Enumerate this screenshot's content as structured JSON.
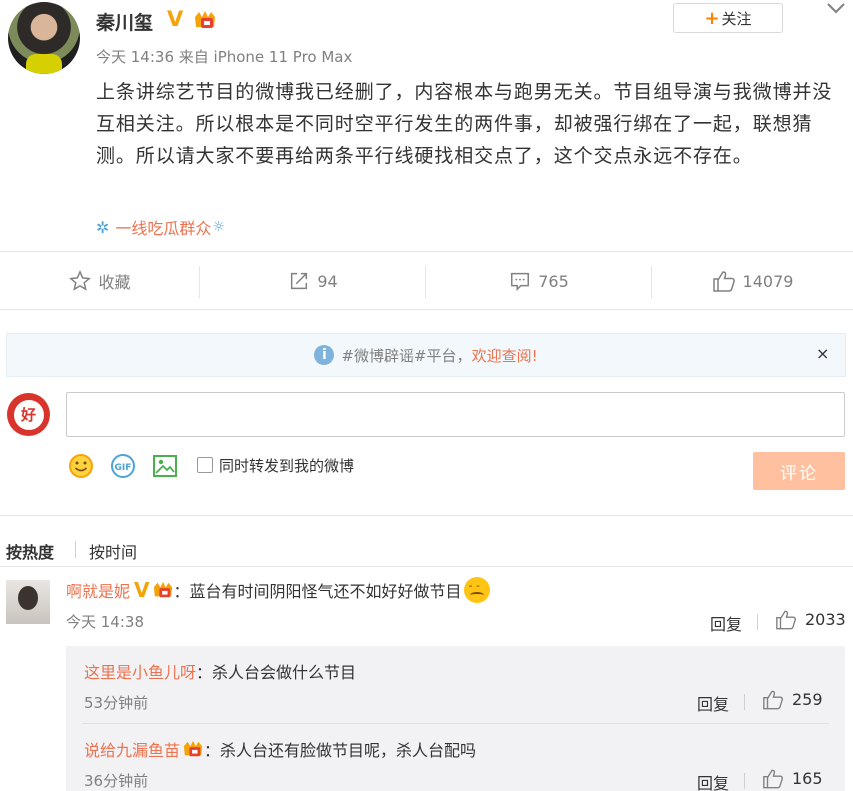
{
  "post": {
    "author": "秦川玺",
    "meta": "今天 14:36 来自 iPhone 11 Pro Max",
    "follow_label": "关注",
    "follow_plus": "+",
    "content": "上条讲综艺节目的微博我已经删了，内容根本与跑男无关。节目组导演与我微博并没互相关注。所以根本是不同时空平行发生的两件事，却被强行绑在了一起，联想猜测。所以请大家不要再给两条平行线硬找相交点了，这个交点永远不存在。",
    "topic_label": "一线吃瓜群众",
    "actions": {
      "favorite": "收藏",
      "forward": "94",
      "comments": "765",
      "likes": "14079"
    }
  },
  "notice": {
    "text": "#微博辟谣#平台，",
    "link": "欢迎查阅!",
    "close": "×"
  },
  "composer": {
    "input_value": "",
    "forward_label": "同时转发到我的微博",
    "submit_label": "评论"
  },
  "sort": {
    "hot": "按热度",
    "time": "按时间"
  },
  "comment": {
    "user": "啊就是妮",
    "text": "：蓝台有时间阴阳怪气还不如好好做节目",
    "time": "今天 14:38",
    "reply": "回复",
    "likes": "2033",
    "replies": [
      {
        "user": "这里是小鱼儿呀",
        "text": "：杀人台会做什么节目",
        "time": "53分钟前",
        "reply": "回复",
        "likes": "259"
      },
      {
        "user": "说给九漏鱼苗",
        "text": "：杀人台还有脸做节目呢，杀人台配吗",
        "time": "36分钟前",
        "reply": "回复",
        "likes": "165"
      }
    ]
  },
  "colors": {
    "accent": "#eb7350",
    "orange": "#ff8200",
    "submit_disabled": "#ffc09f",
    "notice_bg": "#f2f8fc"
  }
}
